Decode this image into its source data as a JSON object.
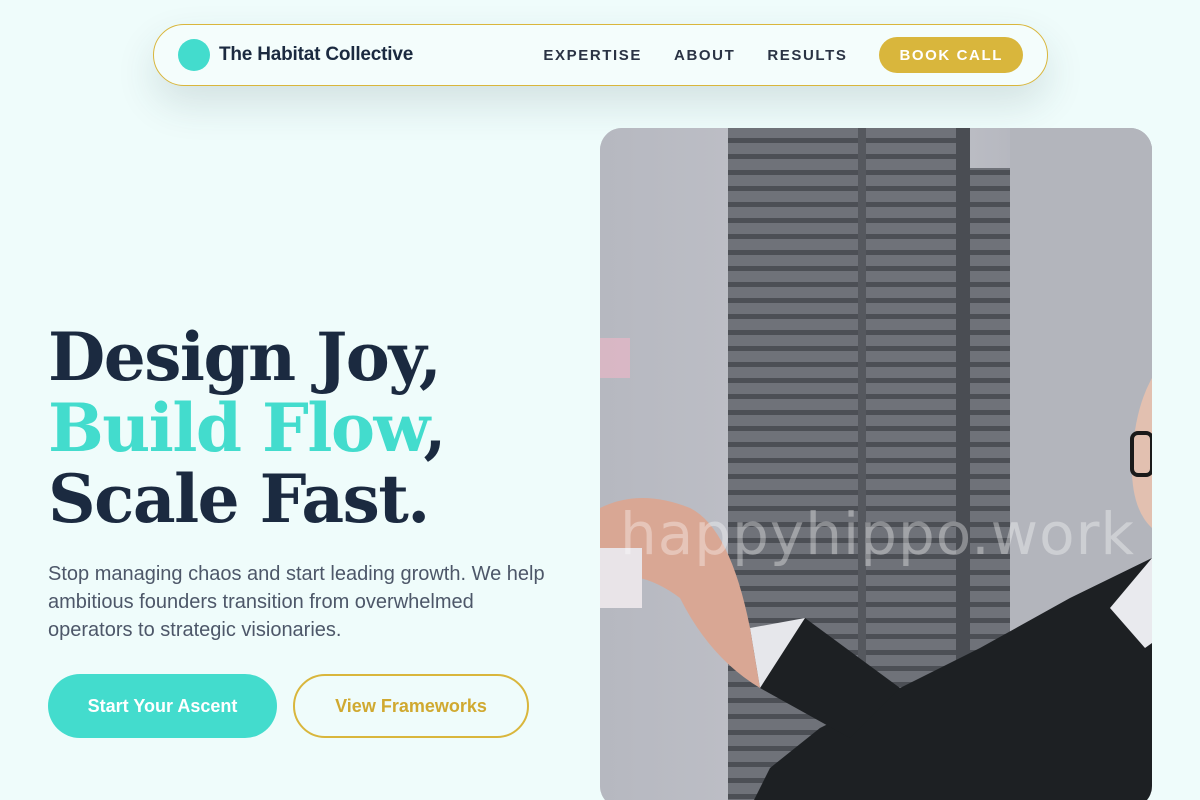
{
  "nav": {
    "brand": "The Habitat Collective",
    "links": [
      "EXPERTISE",
      "ABOUT",
      "RESULTS"
    ],
    "cta": "BOOK CALL"
  },
  "hero": {
    "headline_line1": "Design Joy,",
    "headline_line2_highlight": "Build Flow",
    "headline_line2_rest": ",",
    "headline_line3": "Scale Fast.",
    "subtitle": "Stop managing chaos and start leading growth. We help ambitious founders transition from overwhelmed operators to strategic visionaries.",
    "primary_button": "Start Your Ascent",
    "secondary_button": "View Frameworks"
  },
  "photo": {
    "watermark": "happyhippo.work"
  },
  "colors": {
    "background": "#effcfb",
    "accent_teal": "#43dccd",
    "accent_gold": "#d9b63c",
    "navy": "#1b2a40"
  }
}
